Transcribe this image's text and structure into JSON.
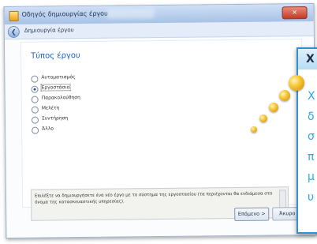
{
  "window": {
    "title": "Οδηγός δημιουργίας έργου",
    "close_glyph": "✕"
  },
  "nav": {
    "back_glyph": "❮",
    "title": "Δημιουργία έργου"
  },
  "content": {
    "heading": "Τύπος έργου",
    "options": [
      {
        "label": "Αυτοματισμός",
        "selected": false
      },
      {
        "label": "Εργοστάσιο",
        "selected": true
      },
      {
        "label": "Παρακολούθηση",
        "selected": false
      },
      {
        "label": "Μελέτη",
        "selected": false
      },
      {
        "label": "Συντήρηση",
        "selected": false
      },
      {
        "label": "Άλλο",
        "selected": false
      }
    ],
    "description": "Επιλέξτε να δημιουργήσετε ένα νέο έργο με το σύστημα της εργοστασίου (τα περιέχονται θα ενδιάμεσα στο όνομα της κατασκευαστικής υπηρεσίας)."
  },
  "buttons": {
    "next": "Επόμενο >",
    "cancel": "Άκυρο"
  },
  "callout": {
    "title": "Χ",
    "lines": [
      "Χ",
      "δ",
      "σ",
      "π",
      "μ",
      "υ"
    ]
  },
  "colors": {
    "accent": "#1f62b8",
    "callout_border": "#2e8fcf",
    "callout_text": "#2aa8e8",
    "bubble": "#f7c735"
  },
  "icons": {
    "app": "wizard-app-icon",
    "back": "back-arrow-icon",
    "close": "close-icon"
  }
}
